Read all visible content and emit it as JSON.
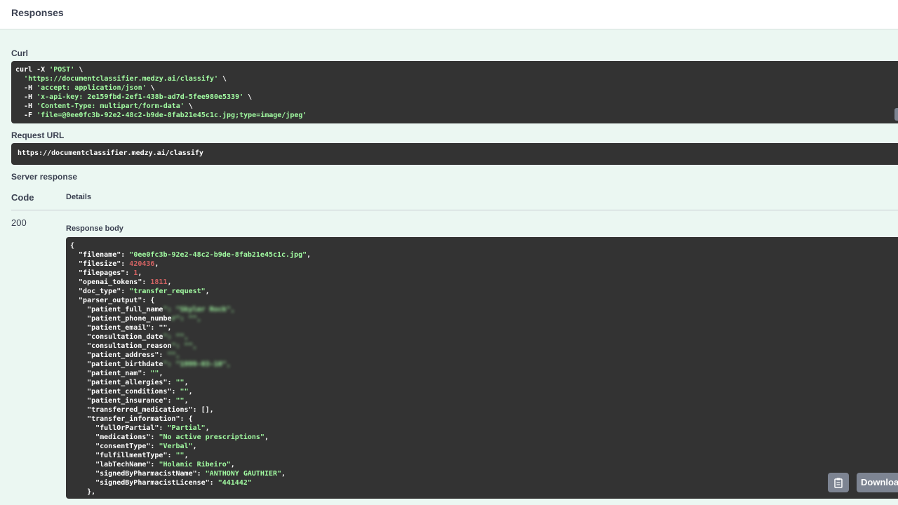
{
  "responses_title": "Responses",
  "curl": {
    "label": "Curl",
    "lines": [
      [
        "curl -X ",
        "'POST'",
        " \\"
      ],
      [
        "  ",
        "'https://documentclassifier.medzy.ai/classify'",
        " \\"
      ],
      [
        "  -H ",
        "'accept: application/json'",
        " \\"
      ],
      [
        "  -H ",
        "'x-api-key: 2e159fbd-2ef1-438b-ad7d-5fee980e5339'",
        " \\"
      ],
      [
        "  -H ",
        "'Content-Type: multipart/form-data'",
        " \\"
      ],
      [
        "  -F ",
        "'file=@0ee0fc3b-92e2-48c2-b9de-8fab21e45c1c.jpg;type=image/jpeg'",
        ""
      ]
    ]
  },
  "request_url": {
    "label": "Request URL",
    "value": "https://documentclassifier.medzy.ai/classify"
  },
  "server_response": {
    "label": "Server response",
    "col_code": "Code",
    "col_details": "Details",
    "code": "200",
    "body_label": "Response body",
    "copy_icon": "clipboard-icon",
    "download_label": "Download",
    "body_lines": [
      [
        [
          "p",
          "{"
        ]
      ],
      [
        [
          "p",
          "  \"filename\": "
        ],
        [
          "s",
          "\"0ee0fc3b-92e2-48c2-b9de-8fab21e45c1c.jpg\""
        ],
        [
          "p",
          ","
        ]
      ],
      [
        [
          "p",
          "  \"filesize\": "
        ],
        [
          "n",
          "420436"
        ],
        [
          "p",
          ","
        ]
      ],
      [
        [
          "p",
          "  \"filepages\": "
        ],
        [
          "n",
          "1"
        ],
        [
          "p",
          ","
        ]
      ],
      [
        [
          "p",
          "  \"openai_tokens\": "
        ],
        [
          "n",
          "1811"
        ],
        [
          "p",
          ","
        ]
      ],
      [
        [
          "p",
          "  \"doc_type\": "
        ],
        [
          "s",
          "\"transfer_request\""
        ],
        [
          "p",
          ","
        ]
      ],
      [
        [
          "p",
          "  \"parser_output\": {"
        ]
      ],
      [
        [
          "p",
          "    \"patient_full_name"
        ],
        [
          "b",
          "\": \"Skyler Rock\","
        ]
      ],
      [
        [
          "p",
          "    \"patient_phone_numbe"
        ],
        [
          "b",
          "r\": \"\","
        ]
      ],
      [
        [
          "p",
          "    \"patient_email\": \"\","
        ]
      ],
      [
        [
          "p",
          "    \"consultation_date"
        ],
        [
          "b",
          "\": \"\","
        ]
      ],
      [
        [
          "p",
          "    \"consultation_reason"
        ],
        [
          "b",
          "\": \"\","
        ]
      ],
      [
        [
          "p",
          "    \"patient_address\": "
        ],
        [
          "b",
          "\"\","
        ]
      ],
      [
        [
          "p",
          "    \"patient_birthdate"
        ],
        [
          "b",
          "\": \"1999-03-10\","
        ]
      ],
      [
        [
          "p",
          "    \"patient_nam\": "
        ],
        [
          "s",
          "\"\""
        ],
        [
          "p",
          ","
        ]
      ],
      [
        [
          "p",
          "    \"patient_allergies\": "
        ],
        [
          "s",
          "\"\""
        ],
        [
          "p",
          ","
        ]
      ],
      [
        [
          "p",
          "    \"patient_conditions\": "
        ],
        [
          "s",
          "\"\""
        ],
        [
          "p",
          ","
        ]
      ],
      [
        [
          "p",
          "    \"patient_insurance\": "
        ],
        [
          "s",
          "\"\""
        ],
        [
          "p",
          ","
        ]
      ],
      [
        [
          "p",
          "    \"transferred_medications\": [],"
        ]
      ],
      [
        [
          "p",
          "    \"transfer_information\": {"
        ]
      ],
      [
        [
          "p",
          "      \"fullOrPartial\": "
        ],
        [
          "s",
          "\"Partial\""
        ],
        [
          "p",
          ","
        ]
      ],
      [
        [
          "p",
          "      \"medications\": "
        ],
        [
          "s",
          "\"No active prescriptions\""
        ],
        [
          "p",
          ","
        ]
      ],
      [
        [
          "p",
          "      \"consentType\": "
        ],
        [
          "s",
          "\"Verbal\""
        ],
        [
          "p",
          ","
        ]
      ],
      [
        [
          "p",
          "      \"fulfillmentType\": "
        ],
        [
          "s",
          "\"\""
        ],
        [
          "p",
          ","
        ]
      ],
      [
        [
          "p",
          "      \"labTechName\": "
        ],
        [
          "s",
          "\"Holanic Ribeiro\""
        ],
        [
          "p",
          ","
        ]
      ],
      [
        [
          "p",
          "      \"signedByPharmacistName\": "
        ],
        [
          "s",
          "\"ANTHONY GAUTHIER\""
        ],
        [
          "p",
          ","
        ]
      ],
      [
        [
          "p",
          "      \"signedByPharmacistLicense\": "
        ],
        [
          "s",
          "\"441442\""
        ]
      ],
      [
        [
          "p",
          "    },"
        ]
      ]
    ]
  }
}
